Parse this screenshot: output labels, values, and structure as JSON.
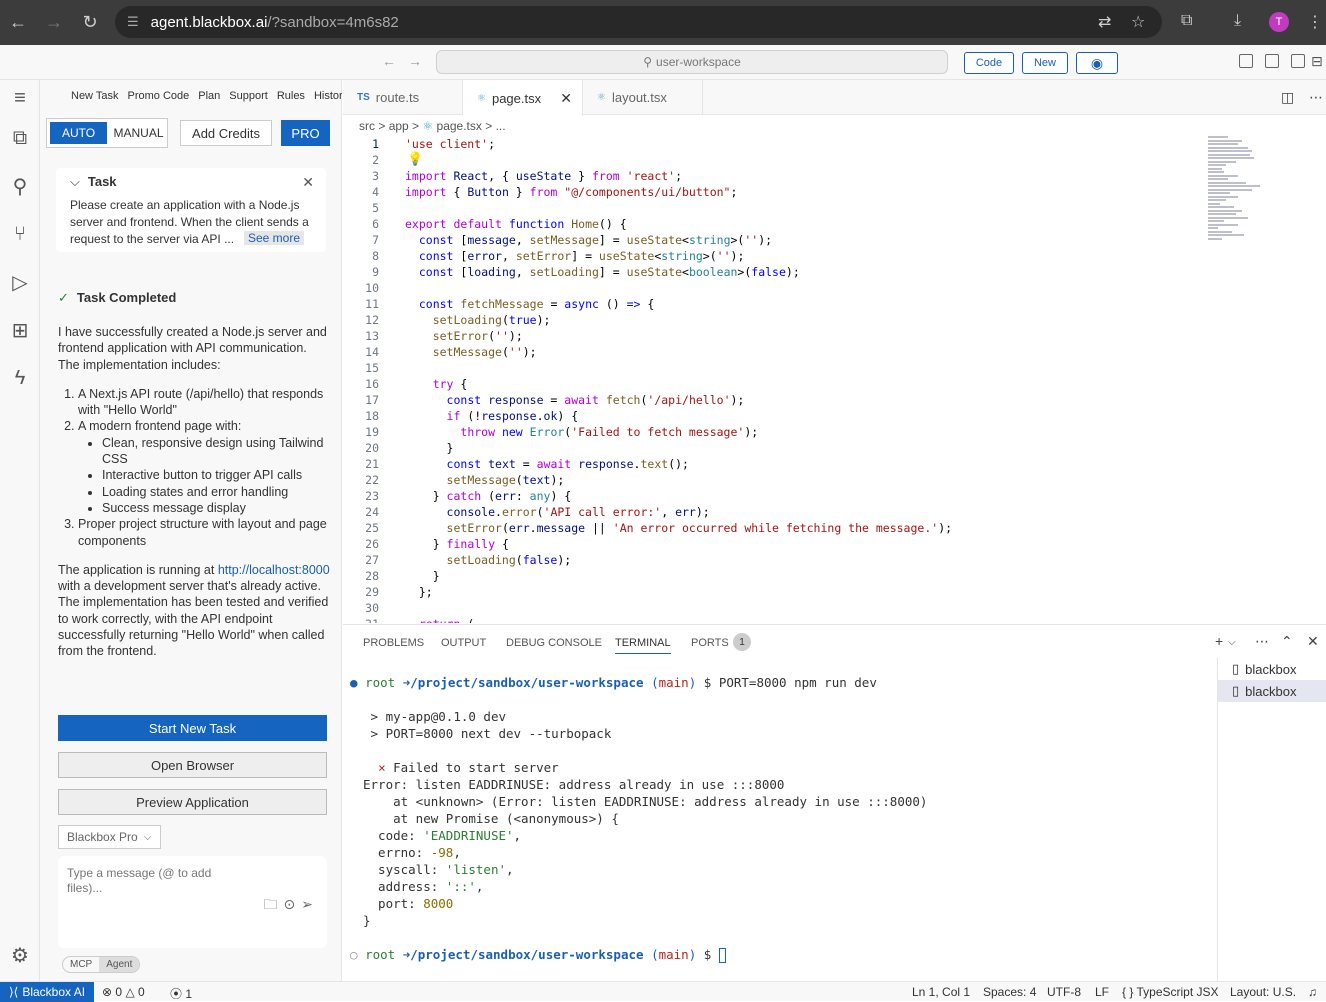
{
  "browser": {
    "url_domain": "agent.blackbox.ai",
    "url_path": "/?sandbox=4m6s82",
    "avatar_letter": "T"
  },
  "topbar": {
    "search": "user-workspace",
    "code_label": "Code",
    "new_label": "New"
  },
  "nav": {
    "items": [
      "New Task",
      "Promo Code",
      "Plan",
      "Support",
      "Rules",
      "History"
    ]
  },
  "mode": {
    "auto": "AUTO",
    "manual": "MANUAL"
  },
  "add_credits": "Add Credits",
  "pro": "PRO",
  "task": {
    "title": "Task",
    "description": "Please create an application with a Node.js server and frontend. When the client sends a request to the server via API ...",
    "see_more": "See more"
  },
  "completed": "Task Completed",
  "summary": {
    "intro": "I have successfully created a Node.js server and frontend application with API communication. The implementation includes:",
    "item1": "A Next.js API route (/api/hello) that responds with \"Hello World\"",
    "item2": "A modern frontend page with:",
    "sub1": "Clean, responsive design using Tailwind CSS",
    "sub2": "Interactive button to trigger API calls",
    "sub3": "Loading states and error handling",
    "sub4": "Success message display",
    "item3": "Proper project structure with layout and page components",
    "foot_pre": "The application is running at ",
    "foot_link": "http://localhost:8000",
    "foot_post": " with a development server that's already active. The implementation has been tested and verified to work correctly, with the API endpoint successfully returning \"Hello World\" when called from the frontend."
  },
  "buttons": {
    "start_new": "Start New Task",
    "open_browser": "Open Browser",
    "preview": "Preview Application"
  },
  "model": "Blackbox Pro",
  "message": {
    "placeholder": "Type a message (@ to add files)..."
  },
  "pills": {
    "mcp": "MCP",
    "agent": "Agent"
  },
  "tabs": [
    {
      "icon": "TS",
      "label": "route.ts"
    },
    {
      "icon": "⚛",
      "label": "page.tsx"
    },
    {
      "icon": "⚛",
      "label": "layout.tsx"
    }
  ],
  "breadcrumb": {
    "a": "src",
    "b": "app",
    "c": "page.tsx",
    "d": "..."
  },
  "panel_tabs": {
    "problems": "PROBLEMS",
    "output": "OUTPUT",
    "debug": "DEBUG CONSOLE",
    "terminal": "TERMINAL",
    "ports": "PORTS",
    "ports_count": "1"
  },
  "terminal": {
    "prompt_user": "root",
    "prompt_path": "/project/sandbox/user-workspace",
    "prompt_branch": "(main)",
    "command": "$ PORT=8000 npm run dev",
    "out1": "> my-app@0.1.0 dev",
    "out2": "> PORT=8000 next dev --turbopack",
    "fail": "Failed to start server",
    "err1": "Error: listen EADDRINUSE: address already in use :::8000",
    "err2": "    at <unknown> (Error: listen EADDRINUSE: address already in use :::8000)",
    "err3": "    at new Promise (<anonymous>) {",
    "code_key": "  code: ",
    "code_val": "'EADDRINUSE'",
    "errno_key": "  errno: ",
    "errno_val": "-98",
    "syscall_key": "  syscall: ",
    "syscall_val": "'listen'",
    "address_key": "  address: ",
    "address_val": "'::'",
    "port_key": "  port: ",
    "port_val": "8000",
    "close": "}",
    "prompt_end": "$"
  },
  "term_list": [
    "blackbox",
    "blackbox"
  ],
  "status": {
    "remote": "Blackbox AI",
    "errors": "0",
    "warnings": "0",
    "ports": "1",
    "pos": "Ln 1, Col 1",
    "spaces": "Spaces: 4",
    "enc": "UTF-8",
    "eol": "LF",
    "lang": "TypeScript JSX",
    "layout": "Layout: U.S."
  }
}
